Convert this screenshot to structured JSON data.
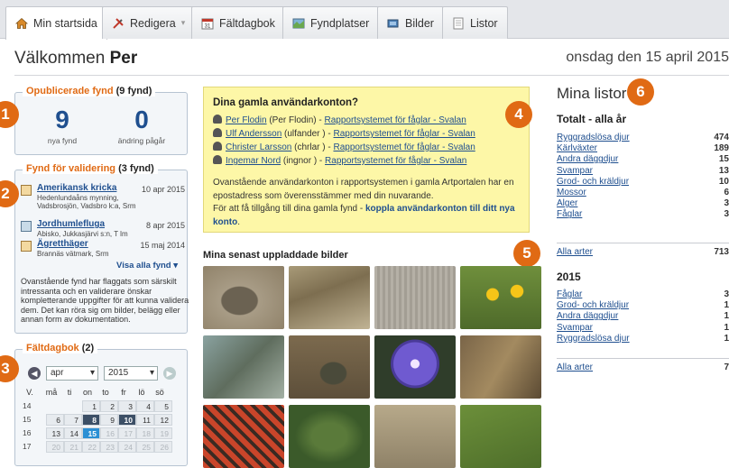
{
  "tabs": [
    {
      "label": "Min startsida",
      "icon": "home-icon",
      "active": true
    },
    {
      "label": "Redigera",
      "icon": "edit-tools-icon",
      "dropdown": true
    },
    {
      "label": "Fältdagbok",
      "icon": "calendar-icon"
    },
    {
      "label": "Fyndplatser",
      "icon": "map-icon"
    },
    {
      "label": "Bilder",
      "icon": "images-icon"
    },
    {
      "label": "Listor",
      "icon": "list-icon"
    }
  ],
  "header": {
    "welcome_prefix": "Välkommen",
    "user": "Per",
    "date": "onsdag den 15 april 2015"
  },
  "badges": [
    "1",
    "2",
    "3",
    "4",
    "5",
    "6"
  ],
  "unpublished": {
    "title": "Opublicerade fynd",
    "count": "(9 fynd)",
    "new_value": "9",
    "new_label": "nya fynd",
    "pending_value": "0",
    "pending_label": "ändring pågår"
  },
  "validation": {
    "title": "Fynd för validering",
    "count": "(3 fynd)",
    "items": [
      {
        "name": "Amerikansk kricka",
        "date": "10 apr 2015",
        "place": "Hedenlundaåns mynning, Vadsbrosjön, Vadsbro k:a, Srm"
      },
      {
        "name": "Jordhumlefluga",
        "date": "8 apr 2015",
        "place": "Abisko, Jukkasjärvi s:n, T lm"
      },
      {
        "name": "Ägretthäger",
        "date": "15 maj 2014",
        "place": "Brannäs vätmark, Srm"
      }
    ],
    "show_all": "Visa alla fynd ▾",
    "note": "Ovanstående fynd har flaggats som särskilt intressanta och en validerare önskar kompletterande uppgifter för att kunna validera dem. Det kan röra sig om bilder, belägg eller annan form av dokumentation."
  },
  "diary": {
    "title": "Fältdagbok",
    "count": "(2)",
    "month": "apr",
    "year": "2015",
    "weekday_headers": [
      "V.",
      "må",
      "ti",
      "on",
      "to",
      "fr",
      "lö",
      "sö"
    ],
    "weeks": [
      {
        "wk": "14",
        "days": [
          "",
          "",
          "1",
          "2",
          "3",
          "4",
          "5"
        ]
      },
      {
        "wk": "15",
        "days": [
          "6",
          "7",
          "8",
          "9",
          "10",
          "11",
          "12"
        ]
      },
      {
        "wk": "16",
        "days": [
          "13",
          "14",
          "15",
          "16",
          "17",
          "18",
          "19"
        ]
      },
      {
        "wk": "17",
        "days": [
          "20",
          "21",
          "22",
          "23",
          "24",
          "25",
          "26"
        ]
      }
    ]
  },
  "old_accounts": {
    "title": "Dina gamla användarkonton?",
    "accounts": [
      {
        "name": "Per Flodin",
        "alias": " (Per Flodin) - ",
        "system": "Rapportsystemet för fåglar - Svalan"
      },
      {
        "name": "Ulf Andersson",
        "alias": " (ulfander ) - ",
        "system": "Rapportsystemet för fåglar - Svalan"
      },
      {
        "name": "Christer Larsson",
        "alias": " (chrlar ) - ",
        "system": "Rapportsystemet för fåglar - Svalan"
      },
      {
        "name": "Ingemar Nord",
        "alias": " (ingnor ) - ",
        "system": "Rapportsystemet för fåglar - Svalan"
      }
    ],
    "text1": "Ovanstående användarkonton i rapportsystemen i gamla Artportalen har en epostadress som överensstämmer med din nuvarande.",
    "text2": "För att få tillgång till dina gamla fynd - ",
    "link": "koppla användarkonton till ditt nya konto",
    "text3": "."
  },
  "images": {
    "title": "Mina senast uppladdade bilder"
  },
  "lists": {
    "title": "Mina listor",
    "total_title": "Totalt - alla år",
    "total": [
      {
        "name": "Ryggradslösa djur",
        "value": "474"
      },
      {
        "name": "Kärlväxter",
        "value": "189"
      },
      {
        "name": "Andra däggdjur",
        "value": "15"
      },
      {
        "name": "Svampar",
        "value": "13"
      },
      {
        "name": "Grod- och kräldjur",
        "value": "10"
      },
      {
        "name": "Mossor",
        "value": "6"
      },
      {
        "name": "Alger",
        "value": "3"
      },
      {
        "name": "Fåglar",
        "value": "3"
      }
    ],
    "total_all": {
      "name": "Alla arter",
      "value": "713"
    },
    "year_title": "2015",
    "year": [
      {
        "name": "Fåglar",
        "value": "3"
      },
      {
        "name": "Grod- och kräldjur",
        "value": "1"
      },
      {
        "name": "Andra däggdjur",
        "value": "1"
      },
      {
        "name": "Svampar",
        "value": "1"
      },
      {
        "name": "Ryggradslösa djur",
        "value": "1"
      }
    ],
    "year_all": {
      "name": "Alla arter",
      "value": "7"
    }
  }
}
